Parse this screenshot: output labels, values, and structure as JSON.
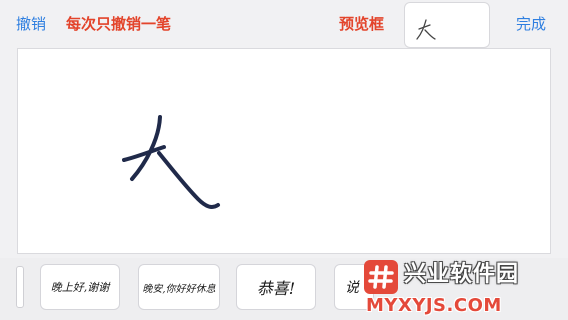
{
  "toolbar": {
    "undo_label": "撤销",
    "undo_annotation": "每次只撤销一笔",
    "preview_annotation": "预览框",
    "preview_char": "大",
    "done_label": "完成"
  },
  "canvas": {
    "drawn_char": "大",
    "stroke_color": "#202a4a"
  },
  "signatures": [
    {
      "text": "晚上好,谢谢"
    },
    {
      "text": "晚安,你好好休息"
    },
    {
      "text": "恭喜!"
    },
    {
      "text": "说"
    }
  ],
  "watermark": {
    "site_name": "兴业软件园",
    "url": "MYXYJS.COM",
    "badge_color": "#e4493a"
  },
  "colors": {
    "accent_blue": "#2f7fe0",
    "annotation_red": "#e3442b"
  }
}
